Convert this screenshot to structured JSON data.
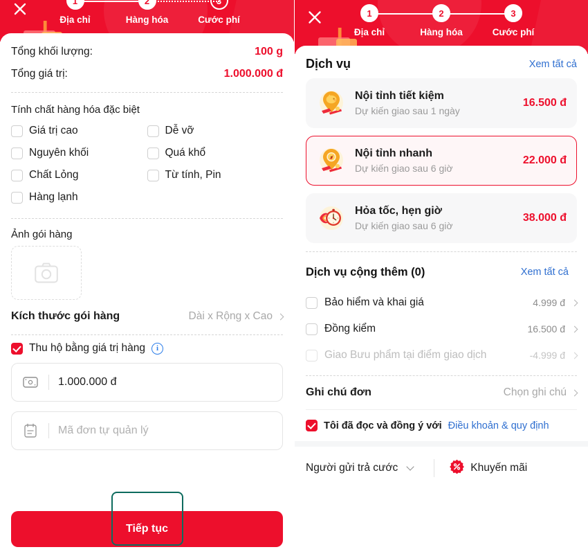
{
  "colors": {
    "brand_red": "#ED0F2C",
    "link_blue": "#2f6fd0",
    "focus_teal": "#0d6b5e",
    "muted_gray": "#9a9a9a"
  },
  "left_panel": {
    "close_icon": "close-icon",
    "stepper": [
      {
        "number": "1",
        "label": "Địa chỉ",
        "state": "done",
        "connector": "solid"
      },
      {
        "number": "2",
        "label": "Hàng hóa",
        "state": "active",
        "connector": "dotted"
      },
      {
        "number": "3",
        "label": "Cước phí",
        "state": "todo",
        "connector": "none"
      }
    ],
    "summary": [
      {
        "label": "Tổng khối lượng:",
        "value": "100 g"
      },
      {
        "label": "Tổng giá trị:",
        "value": "1.000.000 đ"
      }
    ],
    "special_section_title": "Tính chất hàng hóa đặc biệt",
    "special_options": [
      {
        "label": "Giá trị cao",
        "checked": false
      },
      {
        "label": "Dễ vỡ",
        "checked": false
      },
      {
        "label": "Nguyên khối",
        "checked": false
      },
      {
        "label": "Quá khổ",
        "checked": false
      },
      {
        "label": "Chất Lỏng",
        "checked": false
      },
      {
        "label": "Từ tính, Pin",
        "checked": false
      },
      {
        "label": "Hàng lạnh",
        "checked": false
      }
    ],
    "photo_title": "Ảnh gói hàng",
    "photo_icon": "camera-icon",
    "size_row": {
      "label": "Kích thước gói hàng",
      "value": "Dài x Rộng x Cao"
    },
    "cod": {
      "label": "Thu hộ bằng giá trị hàng",
      "checked": true,
      "info_icon": "info-icon",
      "amount_value": "1.000.000 đ",
      "amount_icon": "banknote-icon",
      "order_code_placeholder": "Mã đơn tự quản lý",
      "order_code_icon": "note-icon"
    },
    "cta_label": "Tiếp tục"
  },
  "right_panel": {
    "close_icon": "close-icon",
    "stepper": [
      {
        "number": "1",
        "label": "Địa chỉ",
        "state": "done",
        "connector": "solid"
      },
      {
        "number": "2",
        "label": "Hàng hóa",
        "state": "done",
        "connector": "solid"
      },
      {
        "number": "3",
        "label": "Cước phí",
        "state": "active",
        "connector": "none"
      }
    ],
    "services_header": {
      "title": "Dịch vụ",
      "link": "Xem tất cả"
    },
    "services": [
      {
        "name": "Nội tỉnh tiết kiệm",
        "eta": "Dự kiến giao sau 1 ngày",
        "price": "16.500 đ",
        "selected": false,
        "icon": "piggybank-pin-icon"
      },
      {
        "name": "Nội tỉnh nhanh",
        "eta": "Dự kiến giao sau 6 giờ",
        "price": "22.000 đ",
        "selected": true,
        "icon": "compass-pin-icon"
      },
      {
        "name": "Hỏa tốc, hẹn giờ",
        "eta": "Dự kiến giao sau 6 giờ",
        "price": "38.000 đ",
        "selected": false,
        "icon": "flaming-stopwatch-icon"
      }
    ],
    "addons_header": {
      "title": "Dịch vụ cộng thêm (0)",
      "button": "Xem tất cả"
    },
    "addons": [
      {
        "label": "Bảo hiểm và khai giá",
        "price": "4.999 đ",
        "checked": false,
        "disabled": false
      },
      {
        "label": "Đồng kiểm",
        "price": "16.500 đ",
        "checked": false,
        "disabled": false
      },
      {
        "label": "Giao Bưu phẩm tại điểm giao dịch",
        "price": "-4.999 đ",
        "checked": false,
        "disabled": true
      }
    ],
    "note_row": {
      "label": "Ghi chú đơn",
      "value": "Chọn ghi chú"
    },
    "terms": {
      "checked": true,
      "text": "Tôi đã đọc và đồng ý với",
      "link": "Điều khoản & quy định"
    },
    "bottom": {
      "payer": "Người gửi trả cước",
      "promo": "Khuyến mãi",
      "promo_icon": "promo-badge-icon"
    }
  }
}
